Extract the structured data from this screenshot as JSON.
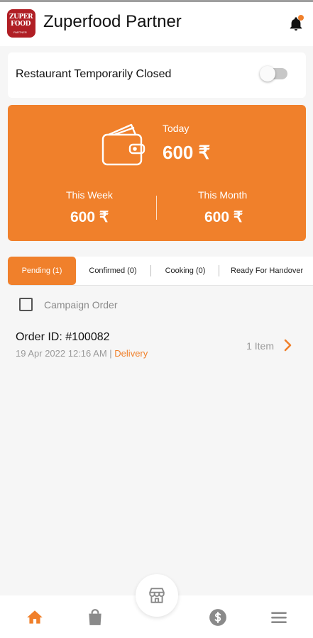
{
  "app": {
    "title": "Zuperfood Partner",
    "logo_line1": "ZUPER",
    "logo_line2": "FOOD",
    "logo_line3": "PARTNER"
  },
  "restaurant_status": {
    "label": "Restaurant Temporarily Closed",
    "toggle_on": false
  },
  "earnings": {
    "today_label": "Today",
    "today_value": "600 ₹",
    "week_label": "This Week",
    "week_value": "600 ₹",
    "month_label": "This Month",
    "month_value": "600 ₹"
  },
  "tabs": [
    {
      "label": "Pending (1)",
      "active": true
    },
    {
      "label": "Confirmed (0)",
      "active": false
    },
    {
      "label": "Cooking (0)",
      "active": false
    },
    {
      "label": "Ready For Handover",
      "active": false
    }
  ],
  "campaign_filter": {
    "label": "Campaign Order",
    "checked": false
  },
  "orders": [
    {
      "id_text": "Order ID: #100082",
      "date": "19 Apr 2022  12:16 AM",
      "separator": "|",
      "type": "Delivery",
      "items": "1 Item"
    }
  ],
  "bottom_nav": {
    "items": [
      "home-icon",
      "bag-icon",
      "store-icon",
      "dollar-icon",
      "menu-icon"
    ],
    "active": "home-icon"
  },
  "colors": {
    "accent": "#f0802b",
    "brand_red": "#b01e24"
  }
}
